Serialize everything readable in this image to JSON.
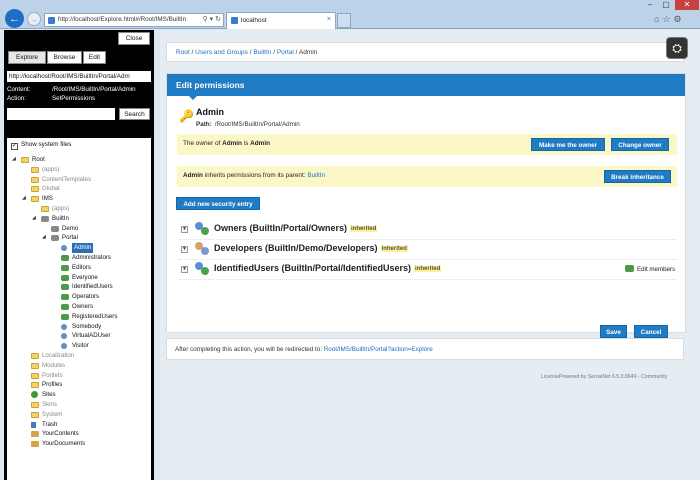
{
  "browser": {
    "address": "http://localhost/Explore.html#/Root/IMS/BuiltIn",
    "tab_title": "localhost",
    "tab_close": "×",
    "window_buttons": {
      "minimize": "–",
      "maximize": "▢",
      "close": "✕"
    }
  },
  "left_panel": {
    "close_label": "Close",
    "toolbar": {
      "explore": "Explore",
      "browse": "Browse",
      "edit": "Edit"
    },
    "url": "http://localhost/Root/IMS/BuiltIn/Portal/Adm",
    "content_label": "Content:",
    "content_value": "/Root/IMS/BuiltIn/Portal/Admin",
    "action_label": "Action:",
    "action_value": "SetPermissions",
    "search_label": "Search",
    "show_system_files": "Show system files",
    "tree": [
      {
        "label": "Root",
        "depth": 0,
        "icon": "folder",
        "toggle": "◢"
      },
      {
        "label": "(apps)",
        "depth": 1,
        "icon": "folder",
        "sys": true
      },
      {
        "label": "ContentTemplates",
        "depth": 1,
        "icon": "folder",
        "sys": true
      },
      {
        "label": "Global",
        "depth": 1,
        "icon": "folder",
        "sys": true
      },
      {
        "label": "IMS",
        "depth": 1,
        "icon": "folder",
        "toggle": "◢"
      },
      {
        "label": "(apps)",
        "depth": 2,
        "icon": "folder",
        "sys": true
      },
      {
        "label": "BuiltIn",
        "depth": 2,
        "icon": "gear",
        "toggle": "◢"
      },
      {
        "label": "Demo",
        "depth": 3,
        "icon": "gear"
      },
      {
        "label": "Portal",
        "depth": 3,
        "icon": "gear",
        "toggle": "◢"
      },
      {
        "label": "Admin",
        "depth": 4,
        "icon": "user",
        "selected": true
      },
      {
        "label": "Administrators",
        "depth": 4,
        "icon": "group"
      },
      {
        "label": "Editors",
        "depth": 4,
        "icon": "group"
      },
      {
        "label": "Everyone",
        "depth": 4,
        "icon": "group"
      },
      {
        "label": "IdentifiedUsers",
        "depth": 4,
        "icon": "group"
      },
      {
        "label": "Operators",
        "depth": 4,
        "icon": "group"
      },
      {
        "label": "Owners",
        "depth": 4,
        "icon": "group"
      },
      {
        "label": "RegisteredUsers",
        "depth": 4,
        "icon": "group"
      },
      {
        "label": "Somebody",
        "depth": 4,
        "icon": "user"
      },
      {
        "label": "VirtualADUser",
        "depth": 4,
        "icon": "user"
      },
      {
        "label": "Visitor",
        "depth": 4,
        "icon": "user"
      },
      {
        "label": "Localization",
        "depth": 1,
        "icon": "folder",
        "sys": true
      },
      {
        "label": "Modules",
        "depth": 1,
        "icon": "folder",
        "sys": true
      },
      {
        "label": "Portlets",
        "depth": 1,
        "icon": "folder",
        "sys": true
      },
      {
        "label": "Profiles",
        "depth": 1,
        "icon": "folder"
      },
      {
        "label": "Sites",
        "depth": 1,
        "icon": "globe"
      },
      {
        "label": "Skins",
        "depth": 1,
        "icon": "folder",
        "sys": true
      },
      {
        "label": "System",
        "depth": 1,
        "icon": "folder",
        "sys": true
      },
      {
        "label": "Trash",
        "depth": 1,
        "icon": "trash"
      },
      {
        "label": "YourContents",
        "depth": 1,
        "icon": "box"
      },
      {
        "label": "YourDocuments",
        "depth": 1,
        "icon": "box"
      }
    ]
  },
  "breadcrumb": {
    "items": [
      "Root",
      "Users and Groups",
      "BuiltIn",
      "Portal"
    ],
    "current": "Admin",
    "separator": " / "
  },
  "panel": {
    "header": "Edit permissions",
    "title": "Admin",
    "path_label": "Path:",
    "path_value": "/Root/IMS/BuiltIn/Portal/Admin",
    "owner_prefix": "The owner of ",
    "owner_subject": "Admin",
    "owner_mid": " is ",
    "owner_name": "Admin",
    "make_owner": "Make me the owner",
    "change_owner": "Change owner",
    "inherit_subject": "Admin",
    "inherit_text": " inherits permissions from its parent: ",
    "inherit_parent": "BuiltIn",
    "break_inheritance": "Break inheritance",
    "add_entry": "Add new security entry",
    "entries": [
      {
        "name": "Owners (BuiltIn/Portal/Owners)",
        "tag": "inherited"
      },
      {
        "name": "Developers (BuiltIn/Demo/Developers)",
        "tag": "inherited"
      },
      {
        "name": "IdentifiedUsers (BuiltIn/Portal/IdentifiedUsers)",
        "tag": "inherited"
      }
    ],
    "edit_members": "Edit members",
    "save": "Save",
    "cancel": "Cancel"
  },
  "redirect": {
    "text": "After completing this action, you will be redirected to: ",
    "link": "Root/IMS/BuiltIn/Portal?action=Explore"
  },
  "footer": "LicensePowered by SenseNet 6.5.3.8649 - Community",
  "colors": {
    "accent": "#1e7bc4",
    "link": "#1e6ec4",
    "highlight": "#fcf7c6"
  }
}
